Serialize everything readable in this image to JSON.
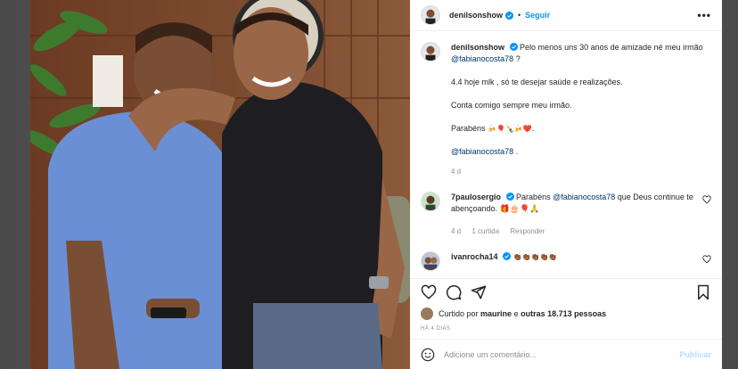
{
  "post": {
    "username": "denilsonshow",
    "follow_label": "Seguir",
    "more_label": "•••",
    "dot_label": "•"
  },
  "caption": {
    "username": "denilsonshow",
    "line1": "Pelo menos uns 30 anos de amizade né meu irmão",
    "mention1": "@fabianocosta78",
    "line1_end": " ?",
    "line2": "4.4 hoje mlk , só te desejar saúde e realizações.",
    "line3": "Conta comigo sempre meu irmão.",
    "line4": "Parabéns",
    "line4_emoji": "🍻🎈🍾🍻❤️.",
    "mention2": "@fabianocosta78",
    "mention2_end": " .",
    "age": "4 d"
  },
  "comments": [
    {
      "username": "7paulosergio",
      "text_before": "Parabéns",
      "mention": "@fabianocosta78",
      "text_after": " que Deus continue te abençoando. 🎁🎂🎈🙏",
      "age": "4 d",
      "replies": "1 curtida",
      "reply_label": "Responder"
    },
    {
      "username": "ivanrocha14",
      "text_before": "👏🏾👏🏾👏🏾👏🏾👏🏾"
    }
  ],
  "likes": {
    "prefix": "Curtido por",
    "user": "maurine",
    "middle": "e",
    "others": "outras 18.713 pessoas"
  },
  "time_ago": "HÁ 4 DIAS",
  "add_comment": {
    "placeholder": "Adicione um comentário...",
    "publish_label": "Publicar"
  },
  "colors": {
    "accent": "#0095f6",
    "mention": "#00376b",
    "muted": "#8e8e8e"
  }
}
